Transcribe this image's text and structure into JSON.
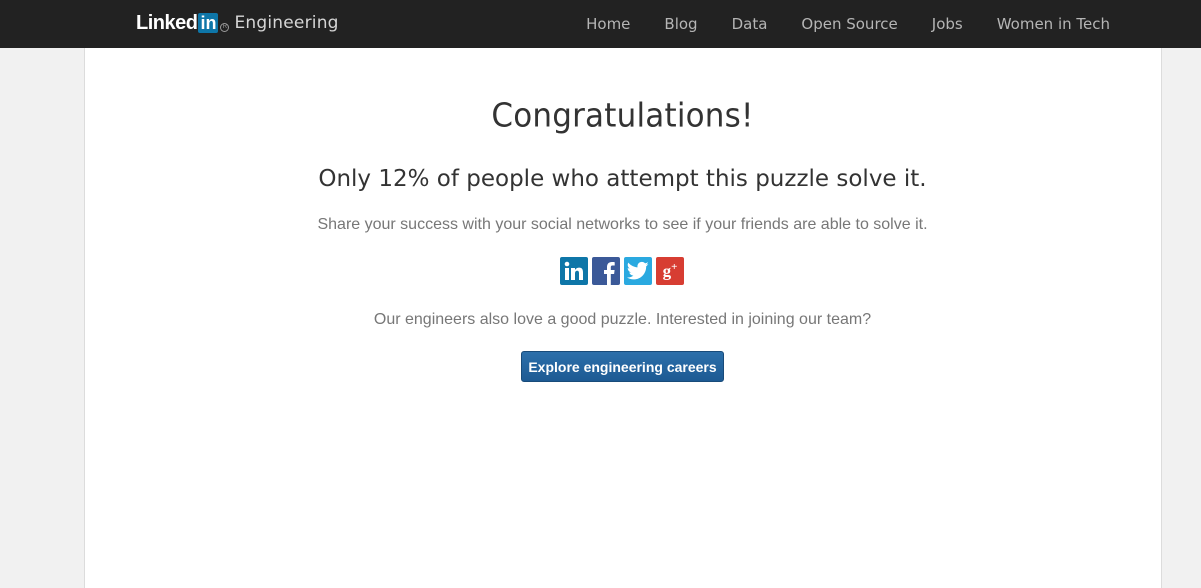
{
  "header": {
    "brand_linked": "Linked",
    "brand_in": "in",
    "brand_registered": "R",
    "brand_suffix": "Engineering",
    "nav": [
      "Home",
      "Blog",
      "Data",
      "Open Source",
      "Jobs",
      "Women in Tech"
    ]
  },
  "main": {
    "title": "Congratulations!",
    "subtitle": "Only 12% of people who attempt this puzzle solve it.",
    "share_text": "Share your success with your social networks to see if your friends are able to solve it.",
    "social_icons": [
      {
        "name": "linkedin-icon",
        "glyph": "in",
        "color": "#0e76a8"
      },
      {
        "name": "facebook-icon",
        "glyph": "f",
        "color": "#3b5998"
      },
      {
        "name": "twitter-icon",
        "glyph": "bird",
        "color": "#2aa9e0"
      },
      {
        "name": "google-plus-icon",
        "glyph": "g+",
        "color": "#d73d32"
      }
    ],
    "careers_text": "Our engineers also love a good puzzle. Interested in joining our team?",
    "cta_label": "Explore engineering careers"
  },
  "colors": {
    "header_bg": "#222222",
    "page_bg": "#f1f1f1",
    "panel_bg": "#ffffff",
    "button_bg": "#2367a0"
  }
}
